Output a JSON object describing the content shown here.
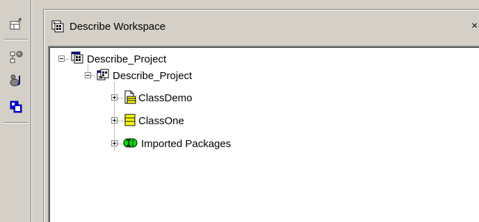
{
  "panel": {
    "title": "Describe Workspace",
    "close_label": "×"
  },
  "toolbar": {
    "items": [
      {
        "name": "new-window-icon"
      },
      {
        "name": "diagram-tool-icon"
      },
      {
        "name": "package-tool-icon"
      },
      {
        "name": "workspace-icon",
        "active": true
      }
    ]
  },
  "tree": {
    "nodes": [
      {
        "label": "Describe_Project",
        "level": 0,
        "icon": "workspace-icon",
        "expander": "minus"
      },
      {
        "label": "Describe_Project",
        "level": 1,
        "icon": "project-icon",
        "expander": "minus"
      },
      {
        "label": "ClassDemo",
        "level": 2,
        "icon": "class-document-icon",
        "expander": "plus"
      },
      {
        "label": "ClassOne",
        "level": 2,
        "icon": "class-icon",
        "expander": "plus"
      },
      {
        "label": "Imported Packages",
        "level": 2,
        "icon": "imported-packages-icon",
        "expander": "plus"
      }
    ]
  },
  "colors": {
    "window_face": "#d4d0c8",
    "tree_background": "#ffffff",
    "class_yellow": "#ffff00",
    "package_green": "#00e000",
    "active_tool_blue": "#0000ff"
  }
}
